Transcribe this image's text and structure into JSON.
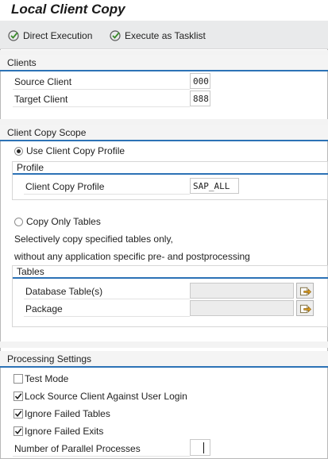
{
  "title": "Local Client Copy",
  "toolbar": {
    "direct_execution": "Direct Execution",
    "execute_as_tasklist": "Execute as Tasklist"
  },
  "clients": {
    "heading": "Clients",
    "source_label": "Source Client",
    "source_value": "000",
    "target_label": "Target Client",
    "target_value": "888"
  },
  "scope": {
    "heading": "Client Copy Scope",
    "use_profile_label": "Use Client Copy Profile",
    "profile_heading": "Profile",
    "profile_label": "Client Copy Profile",
    "profile_value": "SAP_ALL",
    "copy_only_tables_label": "Copy Only Tables",
    "desc_line1": "Selectively copy specified tables only,",
    "desc_line2": "without any application specific pre- and postprocessing",
    "tables_heading": "Tables",
    "db_tables_label": "Database Table(s)",
    "db_tables_value": "",
    "package_label": "Package",
    "package_value": ""
  },
  "processing": {
    "heading": "Processing Settings",
    "test_mode_label": "Test Mode",
    "test_mode_checked": false,
    "lock_label": "Lock Source Client Against User Login",
    "lock_checked": true,
    "ignore_tables_label": "Ignore Failed Tables",
    "ignore_tables_checked": true,
    "ignore_exits_label": "Ignore Failed Exits",
    "ignore_exits_checked": true,
    "parallel_label": "Number of Parallel Processes",
    "parallel_value": ""
  },
  "icons": {
    "execute": "execute-check-icon",
    "value_help": "value-help-icon"
  },
  "colors": {
    "section_underline": "#2c72b6",
    "toolbar_bg": "#e9eaeb"
  }
}
